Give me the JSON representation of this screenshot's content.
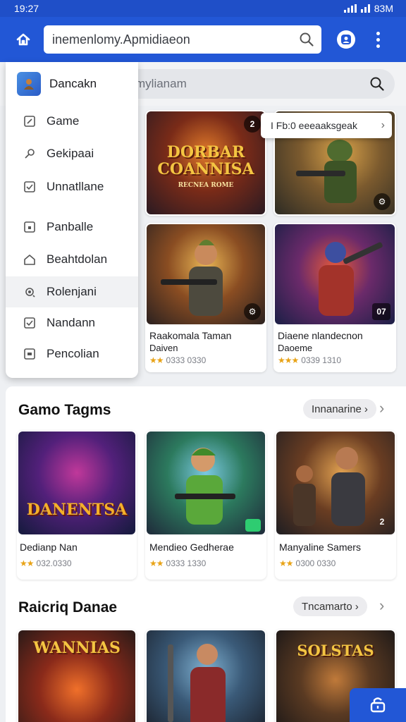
{
  "status_bar": {
    "time": "19:27",
    "battery": "83M"
  },
  "app_bar": {
    "url": "inemenlomy.Apmidiaeon"
  },
  "search": {
    "placeholder": "mylianam"
  },
  "drawer": {
    "title": "Dancakn",
    "items": [
      {
        "label": "Game",
        "icon": "game-icon"
      },
      {
        "label": "Gekipaai",
        "icon": "key-icon"
      },
      {
        "label": "Unnatllane",
        "icon": "check-icon"
      },
      {
        "label": "Panballe",
        "icon": "folder-icon"
      },
      {
        "label": "Beahtdolan",
        "icon": "house-icon"
      },
      {
        "label": "Rolenjani",
        "icon": "gear-icon"
      },
      {
        "label": "Nandann",
        "icon": "checkbox-icon"
      },
      {
        "label": "Pencolian",
        "icon": "card-icon"
      }
    ]
  },
  "popup": {
    "label": "I Fb:0 eeeaaksgeak"
  },
  "featured": {
    "cards": [
      {
        "art_text": "DORBAR COANNISA",
        "art_sub": "RECNEA ROME",
        "badge": "2"
      },
      {
        "art_text": "",
        "badge": "⚙"
      },
      {
        "art_text": "",
        "name": "Raakomala Taman",
        "sub": "Daiven",
        "rating": "0333 0330",
        "badge": "⚙"
      },
      {
        "art_text": "",
        "name": "Diaene nlandecnon",
        "sub": "Daoeme",
        "rating": "0339 1310",
        "badge": "07"
      }
    ]
  },
  "sections": [
    {
      "title": "Gamo Tagms",
      "see_all": "Innanarine",
      "cards": [
        {
          "art_text": "DANENTSA",
          "name": "Dedianp Nan",
          "rating": "032.0330"
        },
        {
          "art_text": "",
          "name": "Mendieo Gedherae",
          "rating": "0333 1330"
        },
        {
          "art_text": "",
          "name": "Manyaline Samers",
          "rating": "0300 0330",
          "badge": "2"
        }
      ]
    },
    {
      "title": "Raicriq Danae",
      "see_all": "Tncamarto",
      "cards": [
        {
          "art_text": "WANNIAS"
        },
        {
          "art_text": ""
        },
        {
          "art_text": "SOLSTAS"
        }
      ]
    }
  ],
  "colors": {
    "primary": "#2257d6",
    "status": "#1f4fc8",
    "star": "#e8a317"
  }
}
